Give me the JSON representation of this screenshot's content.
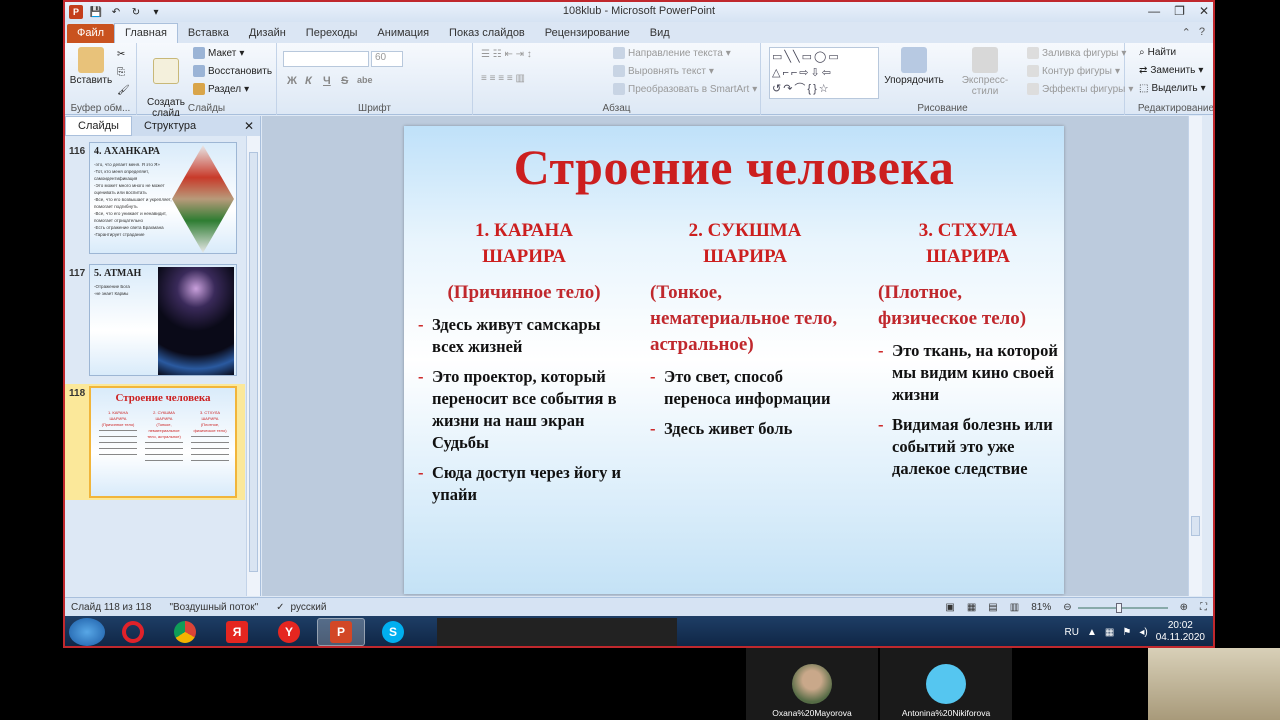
{
  "window": {
    "title": "108klub  -  Microsoft PowerPoint"
  },
  "tabs": [
    "Файл",
    "Главная",
    "Вставка",
    "Дизайн",
    "Переходы",
    "Анимация",
    "Показ слайдов",
    "Рецензирование",
    "Вид"
  ],
  "ribbon": {
    "clipboard": {
      "paste": "Вставить",
      "label": "Буфер обм..."
    },
    "slides": {
      "create": "Создать\nслайд",
      "layout": "Макет",
      "reset": "Восстановить",
      "section": "Раздел",
      "label": "Слайды"
    },
    "font": {
      "size": "60",
      "bold": "Ж",
      "italic": "К",
      "underline": "Ч",
      "strike": "S",
      "shadow": "abe",
      "label": "Шрифт"
    },
    "paragraph": {
      "direction": "Направление текста",
      "align": "Выровнять текст",
      "smartart": "Преобразовать в SmartArt",
      "label": "Абзац"
    },
    "drawing": {
      "arrange": "Упорядочить",
      "quick": "Экспресс-стили",
      "fill": "Заливка фигуры",
      "outline": "Контур фигуры",
      "effects": "Эффекты фигуры",
      "label": "Рисование"
    },
    "editing": {
      "find": "Найти",
      "replace": "Заменить",
      "select": "Выделить",
      "label": "Редактирование"
    }
  },
  "panel": {
    "tab_slides": "Слайды",
    "tab_outline": "Структура",
    "slides": [
      {
        "num": "116",
        "title": "4. АХАНКАРА",
        "lines": [
          "-это, что делает меня. Я это Я»",
          "-Тот, кто меня определяет, самоидентификация",
          "-Это может много много не может оценивать или воспитать",
          "-Все, что его возвышает и укрепляет, помогает подгибнуть",
          "-Все, что его унижает и ненавидит, помогает отрицательно",
          "-Есть отражение света Брахмана",
          "-Гарантирует страдание"
        ]
      },
      {
        "num": "117",
        "title": "5. АТМАН",
        "lines": [
          "-Отражение Бога",
          "-не знает Кармы"
        ]
      },
      {
        "num": "118",
        "title": "Строение человека"
      }
    ]
  },
  "slide": {
    "title": "Строение человека",
    "columns": [
      {
        "head": "1. КАРАНА ШАРИРА",
        "sub": "(Причинное тело)",
        "bullets": [
          "Здесь живут самскары всех жизней",
          "Это проектор, который переносит все события в жизни на наш экран Судьбы",
          "Сюда доступ через йогу и упайи"
        ]
      },
      {
        "head": "2. СУКШМА ШАРИРА",
        "sub": "(Тонкое, нематериальное тело, астральное)",
        "bullets": [
          "Это свет, способ переноса информации",
          "Здесь живет боль"
        ]
      },
      {
        "head": "3. СТХУЛА ШАРИРА",
        "sub": "(Плотное, физическое тело)",
        "bullets": [
          "Это ткань, на которой мы видим кино своей жизни",
          "Видимая болезнь или событий это уже далекое следствие"
        ]
      }
    ]
  },
  "status": {
    "slide": "Слайд 118 из 118",
    "theme": "\"Воздушный поток\"",
    "lang": "русский",
    "zoom": "81%"
  },
  "taskbar": {
    "lang": "RU",
    "time": "20:02",
    "date": "04.11.2020"
  },
  "participants": [
    "Oxana%20Mayorova",
    "Antonina%20Nikiforova"
  ]
}
